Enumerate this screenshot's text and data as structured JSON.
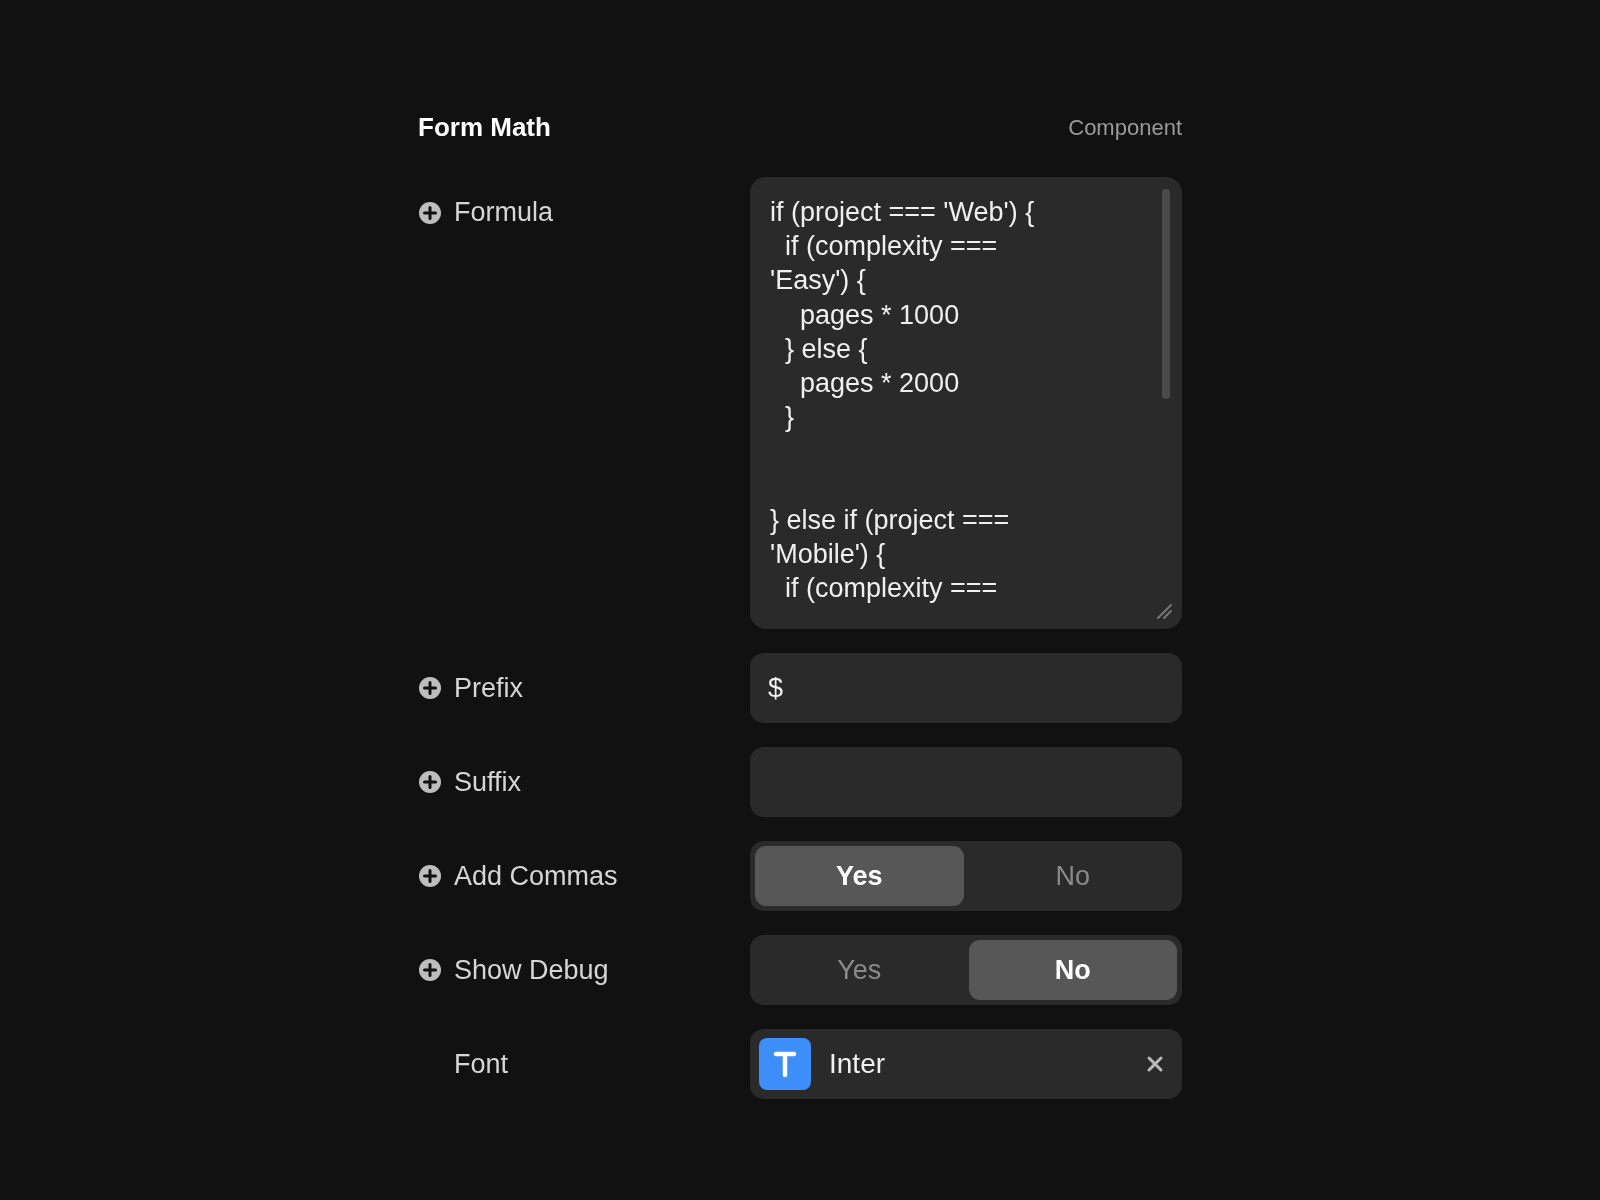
{
  "header": {
    "title": "Form Math",
    "type_label": "Component"
  },
  "fields": [
    {
      "kind": "code",
      "label": "Formula",
      "addable": true,
      "value": "if (project === 'Web') {\n  if (complexity ===\n'Easy') {\n    pages * 1000\n  } else {\n    pages * 2000\n  }\n\n\n} else if (project ===\n'Mobile') {\n  if (complexity ==="
    },
    {
      "kind": "text",
      "label": "Prefix",
      "addable": true,
      "value": "$"
    },
    {
      "kind": "text",
      "label": "Suffix",
      "addable": true
    },
    {
      "kind": "toggle",
      "label": "Add Commas",
      "addable": true,
      "options": [
        {
          "label": "Yes",
          "selected": true
        },
        {
          "label": "No",
          "selected": false
        }
      ]
    },
    {
      "kind": "toggle",
      "label": "Show Debug",
      "addable": true,
      "options": [
        {
          "label": "Yes",
          "selected": false
        },
        {
          "label": "No",
          "selected": true
        }
      ]
    },
    {
      "kind": "font",
      "label": "Font",
      "addable": false,
      "value": "Inter"
    }
  ]
}
